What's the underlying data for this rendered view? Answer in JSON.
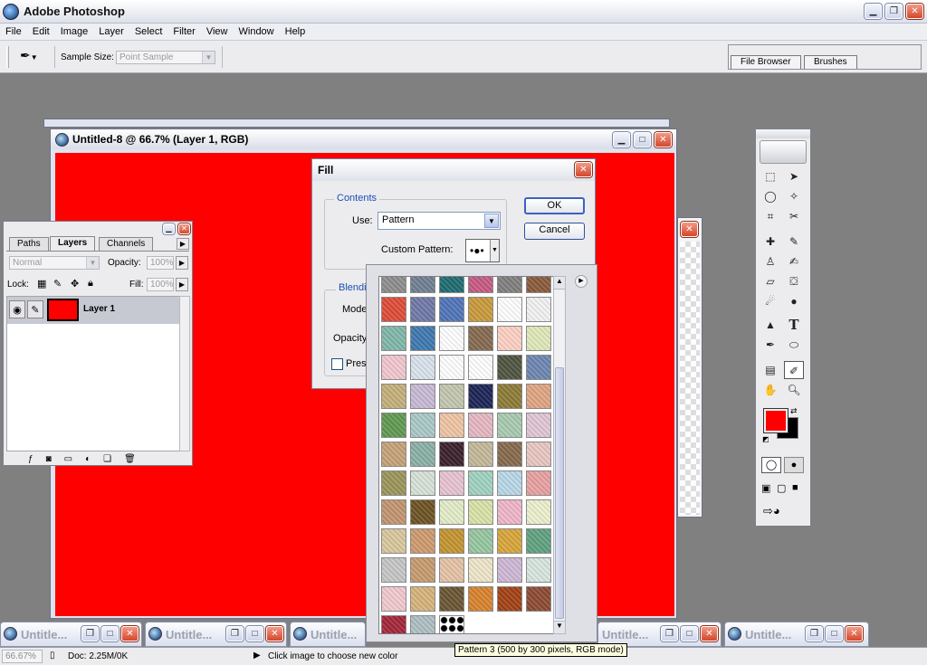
{
  "app": {
    "title": "Adobe Photoshop"
  },
  "menu": [
    "File",
    "Edit",
    "Image",
    "Layer",
    "Select",
    "Filter",
    "View",
    "Window",
    "Help"
  ],
  "options_bar": {
    "sample_size_label": "Sample Size:",
    "sample_size_value": "Point Sample",
    "well_tabs": [
      "File Browser",
      "Brushes"
    ]
  },
  "document": {
    "title": "Untitled-8 @ 66.7% (Layer 1, RGB)",
    "canvas_color": "#ff0000"
  },
  "layers_panel": {
    "tabs": [
      "Paths",
      "Layers",
      "Channels"
    ],
    "blend_mode": "Normal",
    "opacity_label": "Opacity:",
    "opacity_value": "100%",
    "lock_label": "Lock:",
    "fill_label": "Fill:",
    "fill_value": "100%",
    "layer_name": "Layer 1"
  },
  "fill_dialog": {
    "title": "Fill",
    "contents_label": "Contents",
    "use_label": "Use:",
    "use_value": "Pattern",
    "custom_pattern_label": "Custom Pattern:",
    "blending_label": "Blendi",
    "mode_label": "Mode",
    "opacity_label": "Opacity",
    "preserve_label": "Pres",
    "ok_label": "OK",
    "cancel_label": "Cancel"
  },
  "pattern_tooltip": "Pattern 3 (500 by 300 pixels, RGB mode)",
  "patterns": [
    "#8d8d8d",
    "#6f7f92",
    "#1d6b70",
    "#c75982",
    "#807f7e",
    "#8a5a3a",
    "#e04b37",
    "#6f78a8",
    "#4f74b8",
    "#c99a3b",
    "#ffffff",
    "#f2f2f2",
    "#7fb7a9",
    "#3e78b0",
    "#ffffff",
    "#846a4e",
    "#ffd0c4",
    "#dfe8b8",
    "#f3c7cf",
    "#d9e3ee",
    "#ffffff",
    "#ffffff",
    "#4f5440",
    "#6d86b0",
    "#c4b07a",
    "#c8bad6",
    "#c3c7af",
    "#1b2456",
    "#8d7b35",
    "#e0a582",
    "#5f9a50",
    "#a9c9c8",
    "#f0c4a4",
    "#e6b7c2",
    "#a8cbb0",
    "#e2c6d6",
    "#c5a278",
    "#89b0a6",
    "#3a1f2a",
    "#c4b89a",
    "#856a4c",
    "#e9c7c1",
    "#9b9559",
    "#d7e2d7",
    "#e8c3d1",
    "#9fd3c0",
    "#b9d8e8",
    "#e9a0a0",
    "#c29570",
    "#6d5223",
    "#e3edc8",
    "#d9e2a7",
    "#f0b6c9",
    "#eef0cf",
    "#d8c89c",
    "#cf9a6d",
    "#c4942f",
    "#96c7a0",
    "#d8a53a",
    "#5ea280",
    "#c6c6c6",
    "#c79b6e",
    "#e5c3a6",
    "#efe6c9",
    "#cfb8d6",
    "#d8e6e0",
    "#f2c9ce",
    "#d7b47a",
    "#6a5533",
    "#d9822c",
    "#a34014",
    "#8d4a32",
    "#a32638",
    "#aebfc2",
    "#ffffff"
  ],
  "status": {
    "zoom": "66.67%",
    "doc_size": "Doc: 2.25M/0K",
    "message": "Click image to choose new color"
  },
  "taskbar_windows": [
    "Untitle...",
    "Untitle...",
    "Untitle...",
    "Untitle...",
    "Untitle..."
  ],
  "colors": {
    "foreground": "#ff0000",
    "background": "#000000"
  }
}
